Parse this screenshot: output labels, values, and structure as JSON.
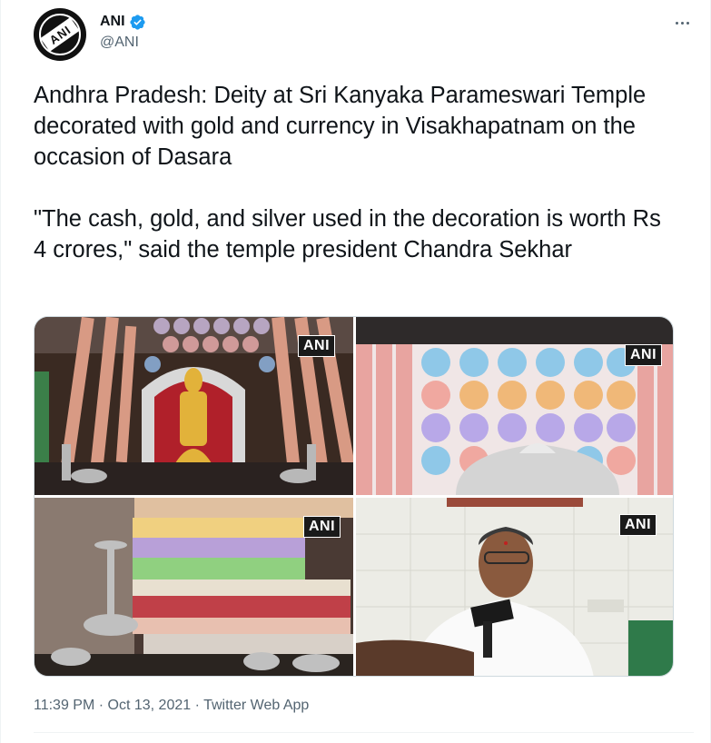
{
  "author": {
    "display_name": "ANI",
    "handle": "@ANI",
    "verified": true,
    "avatar_logo_text": "ANI"
  },
  "tweet": {
    "text": "Andhra Pradesh: Deity at Sri Kanyaka Parameswari Temple decorated with gold and currency in Visakhapatnam on the occasion of Dasara\n\n\"The cash, gold, and silver used in the decoration is worth Rs 4 crores,\" said the temple president Chandra Sekhar"
  },
  "media": {
    "watermarks": [
      "ANI",
      "ANI",
      "ANI",
      "ANI"
    ],
    "photo_count": 4
  },
  "footer": {
    "time": "11:39 PM",
    "separator": "·",
    "date": "Oct 13, 2021",
    "source": "Twitter Web App"
  },
  "icons": {
    "verified": "verified-badge-icon",
    "more": "more-horizontal-icon"
  },
  "colors": {
    "verified_blue": "#1d9bf0",
    "secondary_text": "#536471",
    "primary_text": "#0f1419"
  }
}
